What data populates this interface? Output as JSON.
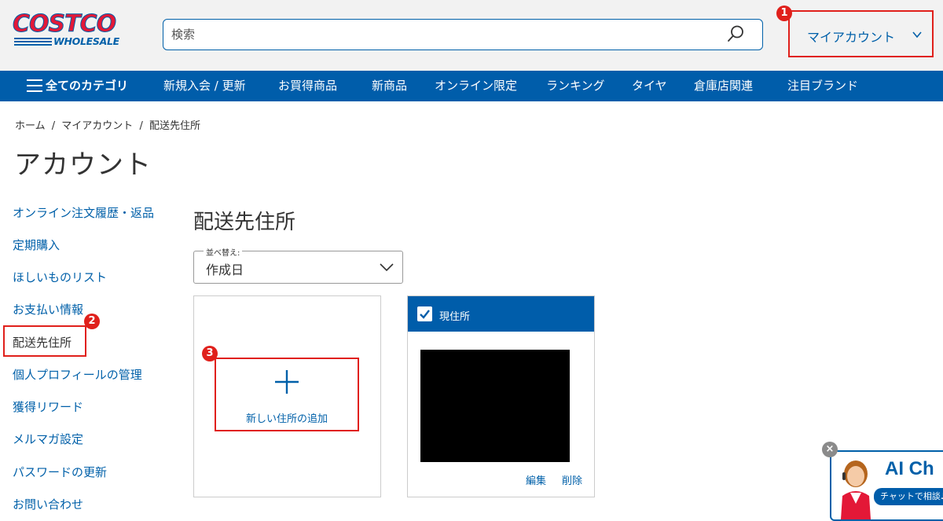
{
  "header": {
    "logo_main": "COSTCO",
    "logo_sub": "WHOLESALE",
    "search_placeholder": "検索",
    "account_label": "マイアカウント"
  },
  "nav": {
    "all_categories": "全てのカテゴリ",
    "items": [
      "新規入会 / 更新",
      "お買得商品",
      "新商品",
      "オンライン限定",
      "ランキング",
      "タイヤ",
      "倉庫店関連",
      "注目ブランド"
    ]
  },
  "breadcrumb": [
    "ホーム",
    "/",
    "マイアカウント",
    "/",
    "配送先住所"
  ],
  "page_title": "アカウント",
  "sidebar": {
    "items": [
      {
        "label": "オンライン注文履歴・返品"
      },
      {
        "label": "定期購入"
      },
      {
        "label": "ほしいものリスト"
      },
      {
        "label": "お支払い情報"
      },
      {
        "label": "配送先住所"
      },
      {
        "label": "個人プロフィールの管理"
      },
      {
        "label": "獲得リワード"
      },
      {
        "label": "メルマガ設定"
      },
      {
        "label": "パスワードの更新"
      },
      {
        "label": "お問い合わせ"
      }
    ]
  },
  "main": {
    "section_title": "配送先住所",
    "sort": {
      "label": "並べ替え:",
      "value": "作成日"
    },
    "add_card": {
      "label": "新しい住所の追加"
    },
    "address_card": {
      "header_label": "現住所",
      "edit": "編集",
      "delete": "削除"
    }
  },
  "annotations": {
    "badge1": "1",
    "badge2": "2",
    "badge3": "3"
  },
  "chat": {
    "title": "AI Ch",
    "button": "チャットで相談♪",
    "close": "×"
  },
  "colors": {
    "brand_blue": "#005daa",
    "brand_red": "#e31837",
    "annotation_red": "#e0201b"
  }
}
